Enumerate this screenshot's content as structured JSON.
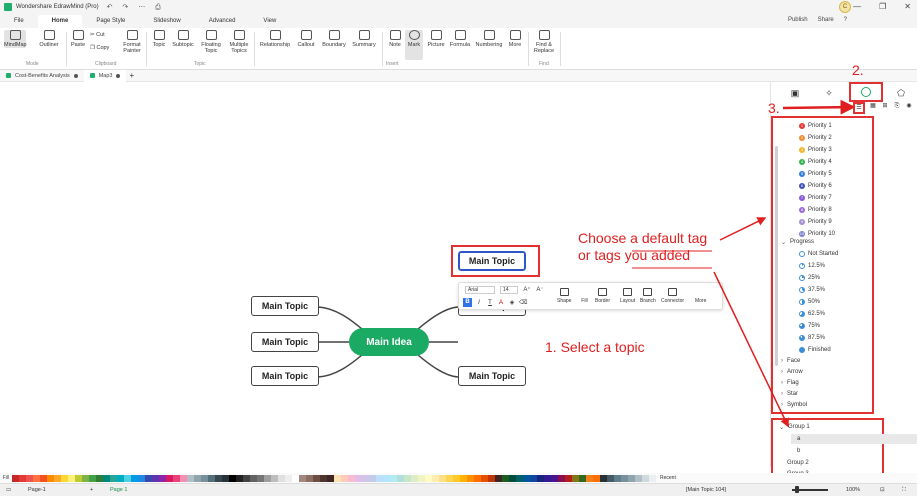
{
  "window": {
    "title": "Wondershare EdrawMind (Pro)",
    "quick_access": "↶ ↷ ⋯ ⎙",
    "user_initial": "C",
    "controls": [
      "—",
      "❐",
      "✕"
    ]
  },
  "menu": {
    "tabs": [
      "File",
      "Home",
      "Page Style",
      "Slideshow",
      "Advanced",
      "View"
    ],
    "active": "Home",
    "publish": "Publish",
    "share": "Share",
    "help": "?"
  },
  "ribbon": {
    "buttons": [
      {
        "label": "MindMap",
        "name": "mindmap-button"
      },
      {
        "label": "Outliner",
        "name": "outliner-button"
      },
      {
        "label": "Paste",
        "name": "paste-button"
      },
      {
        "label": "Cut",
        "name": "cut-button"
      },
      {
        "label": "Copy",
        "name": "copy-button"
      },
      {
        "label": "Format Painter",
        "name": "format-painter-button"
      },
      {
        "label": "Topic",
        "name": "topic-button"
      },
      {
        "label": "Subtopic",
        "name": "subtopic-button"
      },
      {
        "label": "Floating Topic",
        "name": "floating-topic-button"
      },
      {
        "label": "Multiple Topics",
        "name": "multiple-topics-button"
      },
      {
        "label": "Relationship",
        "name": "relationship-button"
      },
      {
        "label": "Callout",
        "name": "callout-button"
      },
      {
        "label": "Boundary",
        "name": "boundary-button"
      },
      {
        "label": "Summary",
        "name": "summary-button"
      },
      {
        "label": "Note",
        "name": "note-button"
      },
      {
        "label": "Mark",
        "name": "mark-button"
      },
      {
        "label": "Picture",
        "name": "picture-button"
      },
      {
        "label": "Formula",
        "name": "formula-button"
      },
      {
        "label": "Numbering",
        "name": "numbering-button"
      },
      {
        "label": "More",
        "name": "more-button"
      },
      {
        "label": "Find & Replace",
        "name": "find-replace-button"
      }
    ],
    "groups": [
      "Mode",
      "Clipboard",
      "Topic",
      "Insert",
      "Find"
    ]
  },
  "doc_tabs": [
    {
      "label": "Cost-Benefits Analysis"
    },
    {
      "label": "Map3"
    }
  ],
  "new_tab": "+",
  "mindmap": {
    "main_idea": "Main Idea",
    "topics": [
      "Main Topic",
      "Main Topic",
      "Main Topic",
      "Main Topic",
      "Main Topic",
      "Main Topic"
    ]
  },
  "float_toolbar": {
    "font": "Arial",
    "size": "14",
    "grow": "A⁺",
    "shrink": "A⁻",
    "bold": "B",
    "italic": "I",
    "underline": "T",
    "color": "A",
    "fill_ic": "◈",
    "eraser": "⌫",
    "tools": [
      "Shape",
      "Fill",
      "Border",
      "Layout",
      "Branch",
      "Connector",
      "More"
    ]
  },
  "annotations": {
    "step1": "1. Select a topic",
    "step2": "2.",
    "step3": "3.",
    "callout_line1": "Choose a default tag",
    "callout_line2": "or tags you added"
  },
  "right_panel": {
    "priorities": [
      "Priority 1",
      "Priority 2",
      "Priority 3",
      "Priority 4",
      "Priority 5",
      "Priority 6",
      "Priority 7",
      "Priority 8",
      "Priority 9",
      "Priority 10"
    ],
    "priority_colors": [
      "#e53935",
      "#f08c2e",
      "#f2b52c",
      "#37b24d",
      "#2f7de1",
      "#3f51b5",
      "#8e5bd6",
      "#9c6ad8",
      "#a68fd1",
      "#7b7fd1"
    ],
    "progress_title": "Progress",
    "progress": [
      "Not Started",
      "12.5%",
      "25%",
      "37.5%",
      "50%",
      "62.5%",
      "75%",
      "87.5%",
      "Finished"
    ],
    "sections": [
      "Face",
      "Arrow",
      "Flag",
      "Star",
      "Symbol"
    ],
    "groups": [
      {
        "label": "Group 1",
        "items": [
          "a",
          "b"
        ]
      },
      {
        "label": "Group 2"
      },
      {
        "label": "Group 3"
      }
    ]
  },
  "palette": {
    "label": "Fill",
    "colors": [
      "#c62828",
      "#e53935",
      "#ef5350",
      "#ff7043",
      "#f4511e",
      "#fb8c00",
      "#ffa726",
      "#fdd835",
      "#fff176",
      "#c0ca33",
      "#7cb342",
      "#43a047",
      "#2e7d32",
      "#00897b",
      "#26a69a",
      "#00acc1",
      "#4dd0e1",
      "#039be5",
      "#1e88e5",
      "#3949ab",
      "#5e35b1",
      "#8e24aa",
      "#d81b60",
      "#ec407a",
      "#f48fb1",
      "#b0bec5",
      "#90a4ae",
      "#78909c",
      "#546e7a",
      "#37474f",
      "#263238",
      "#000000",
      "#212121",
      "#424242",
      "#616161",
      "#757575",
      "#9e9e9e",
      "#bdbdbd",
      "#e0e0e0",
      "#eeeeee",
      "#ffffff",
      "#a1887f",
      "#8d6e63",
      "#6d4c41",
      "#4e342e",
      "#3e2723",
      "#ffe0b2",
      "#ffccbc",
      "#f8bbd0",
      "#e1bee7",
      "#d1c4e9",
      "#c5cae9",
      "#bbdefb",
      "#b3e5fc",
      "#b2ebf2",
      "#b2dfdb",
      "#c8e6c9",
      "#dcedc8",
      "#f0f4c3",
      "#fff9c4",
      "#ffecb3",
      "#ffe082",
      "#ffd54f",
      "#ffca28",
      "#ffb300",
      "#ff8f00",
      "#ff6f00",
      "#e65100",
      "#bf360c",
      "#3e2723",
      "#1b5e20",
      "#004d40",
      "#006064",
      "#01579b",
      "#0d47a1",
      "#1a237e",
      "#311b92",
      "#4a148c",
      "#880e4f",
      "#b71c1c",
      "#827717",
      "#33691e",
      "#f57f17",
      "#ff6f00",
      "#263238",
      "#455a64",
      "#607d8b",
      "#78909c",
      "#90a4ae",
      "#b0bec5",
      "#cfd8dc",
      "#eceff1"
    ],
    "recent": "Recent"
  },
  "status": {
    "page_selector": "Page-1",
    "page_tab": "Page 1",
    "selection": "[Main Topic 104]",
    "zoom": "100%",
    "add_page": "+"
  }
}
